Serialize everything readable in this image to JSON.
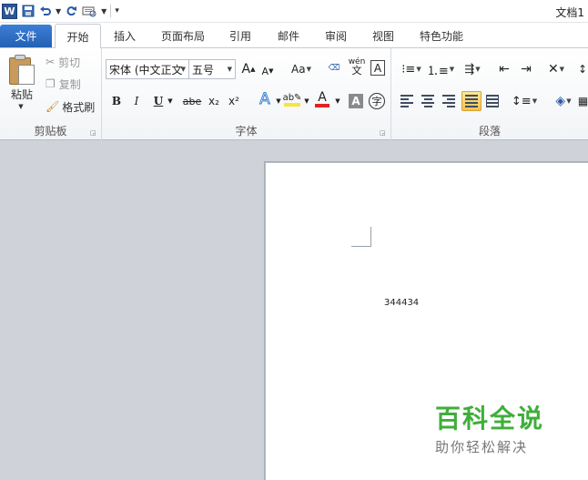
{
  "app": {
    "doc_title": "文档1",
    "logo_letter": "W"
  },
  "tabs": [
    {
      "label": "文件"
    },
    {
      "label": "开始"
    },
    {
      "label": "插入"
    },
    {
      "label": "页面布局"
    },
    {
      "label": "引用"
    },
    {
      "label": "邮件"
    },
    {
      "label": "审阅"
    },
    {
      "label": "视图"
    },
    {
      "label": "特色功能"
    }
  ],
  "clipboard": {
    "paste": "粘贴",
    "cut": "剪切",
    "copy": "复制",
    "format_painter": "格式刷",
    "group_label": "剪贴板"
  },
  "font": {
    "font_name": "宋体 (中文正文",
    "font_size": "五号",
    "group_label": "字体",
    "bold": "B",
    "italic": "I",
    "underline": "U",
    "strike": "abe",
    "subscript": "x₂",
    "superscript": "x²",
    "grow": "A",
    "shrink": "A",
    "change_case": "Aa",
    "font_color_letter": "A",
    "char_shading": "A",
    "enclose": "字",
    "phonetic": "wén",
    "border": "A"
  },
  "paragraph": {
    "group_label": "段落"
  },
  "document": {
    "text": "344434"
  },
  "watermark": {
    "title": "百科全说",
    "subtitle": "助你轻松解决"
  },
  "colors": {
    "file_tab": "#2b6bc1",
    "font_color_bar": "#e32222",
    "highlight_bar": "#f8e53a",
    "watermark_green": "#3fae3a"
  }
}
